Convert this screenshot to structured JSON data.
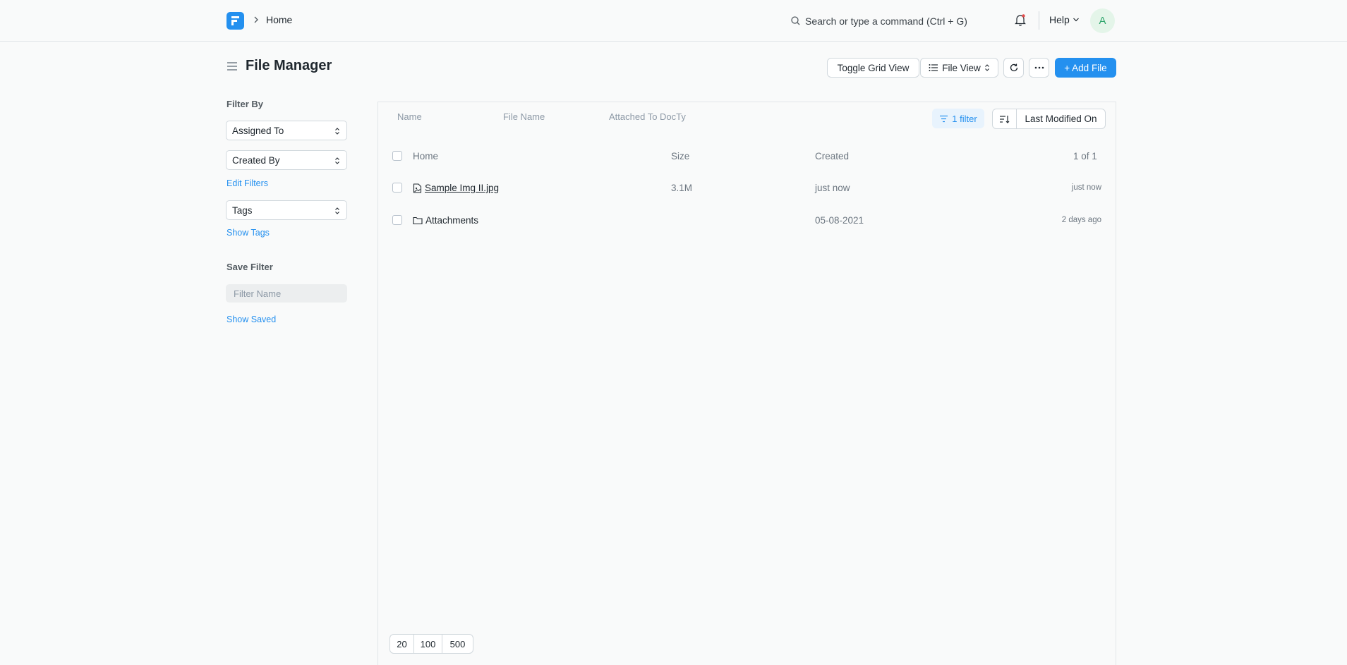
{
  "navbar": {
    "breadcrumb_home": "Home",
    "search_placeholder": "Search or type a command (Ctrl + G)",
    "help_label": "Help",
    "avatar_initial": "A",
    "logo_color": "#2490ef"
  },
  "page": {
    "title": "File Manager"
  },
  "toolbar": {
    "toggle_grid_label": "Toggle Grid View",
    "file_view_label": "File View",
    "add_file_label": "+ Add File"
  },
  "sidebar": {
    "filter_by_label": "Filter By",
    "assigned_to": "Assigned To",
    "created_by": "Created By",
    "edit_filters": "Edit Filters",
    "tags": "Tags",
    "show_tags": "Show Tags",
    "save_filter_label": "Save Filter",
    "filter_name_placeholder": "Filter Name",
    "show_saved": "Show Saved"
  },
  "list_filters": {
    "name_placeholder": "Name",
    "file_name_placeholder": "File Name",
    "attached_to_placeholder": "Attached To DocTy",
    "filter_badge": "1 filter",
    "sort_label": "Last Modified On"
  },
  "table": {
    "headers": {
      "name": "Home",
      "size": "Size",
      "created": "Created",
      "count": "1 of 1"
    },
    "rows": [
      {
        "name": "Sample Img II.jpg",
        "icon": "image-file-icon",
        "size": "3.1M",
        "created": "just now",
        "modified": "just now"
      },
      {
        "name": "Attachments",
        "icon": "folder-icon",
        "size": "",
        "created": "05-08-2021",
        "modified": "2 days ago"
      }
    ]
  },
  "pager": {
    "options": [
      "20",
      "100",
      "500"
    ]
  }
}
